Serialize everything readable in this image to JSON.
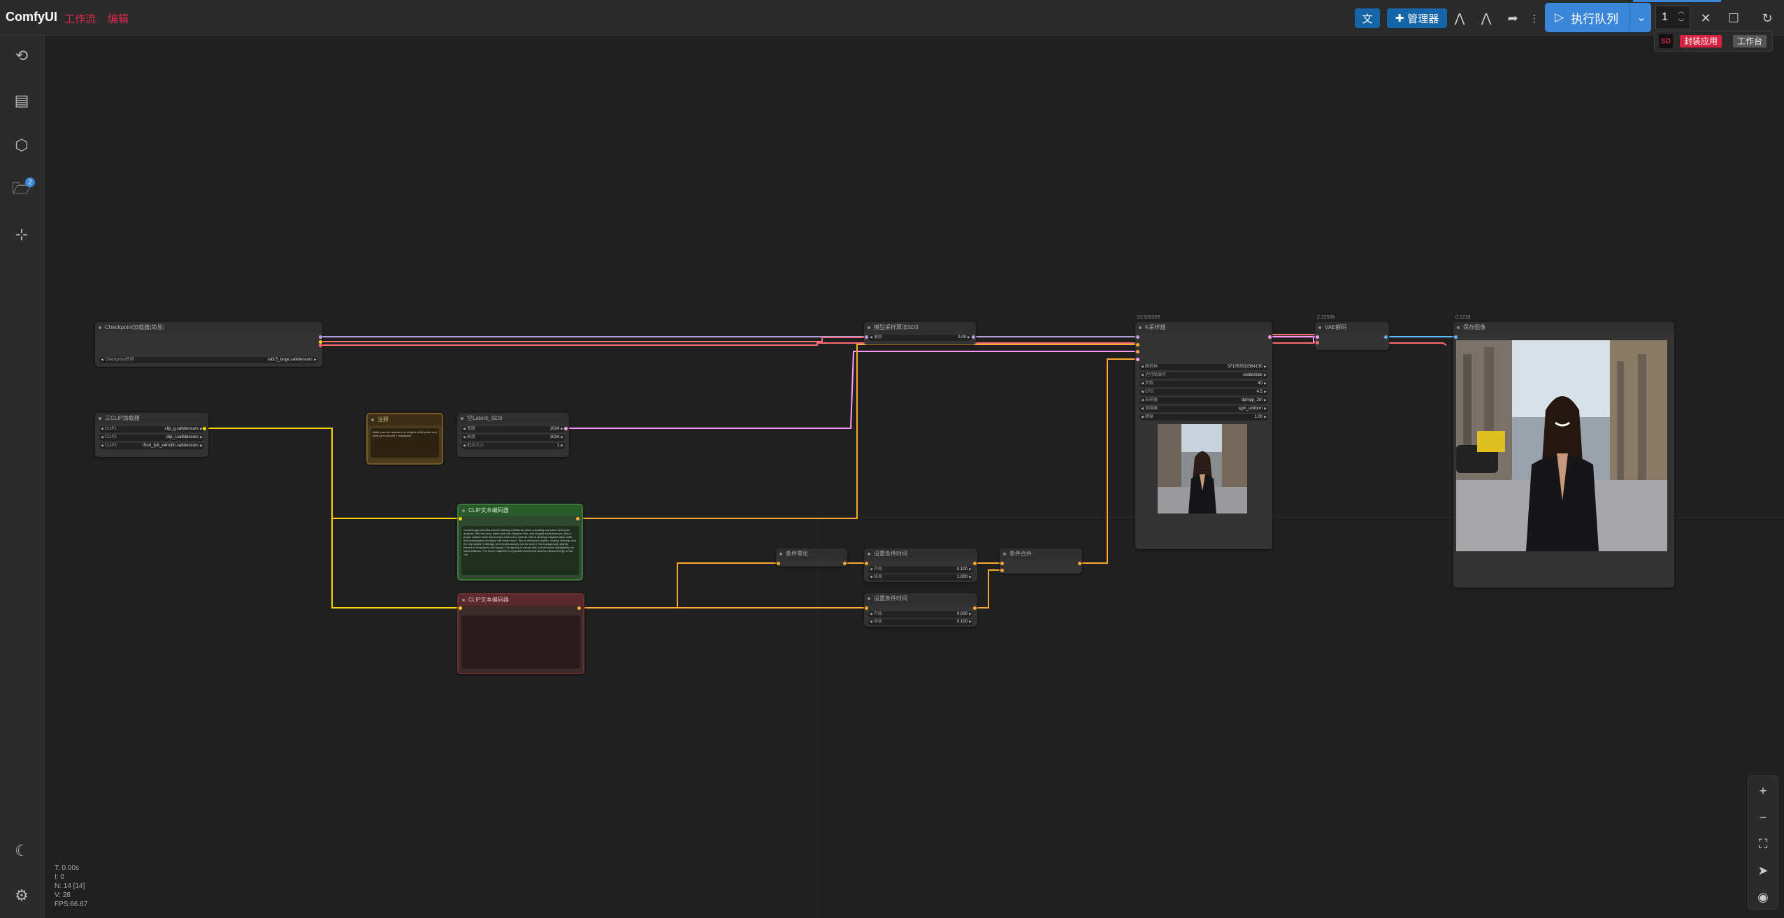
{
  "app": {
    "title": "ComfyUI",
    "menu": [
      "工作流",
      "编辑"
    ]
  },
  "toolbar": {
    "translate_label": "文",
    "manager_label": "管理器",
    "run_label": "执行队列",
    "batch_count": "1",
    "ext_logo": "SD",
    "ext_publish": "封装应用",
    "ext_workbench": "工作台"
  },
  "sidebar": {
    "queue_badge": "2"
  },
  "nodes": {
    "checkpoint": {
      "title": "Checkpoint加载器(简易)",
      "widget_label": "Checkpoint名称",
      "widget_value": "sd3.5_large.safetensors"
    },
    "clip_loader": {
      "title": "三CLIP加载器",
      "w1_label": "CLIP1",
      "w1_value": "clip_g.safetensors",
      "w2_label": "CLIP2",
      "w2_value": "clip_l.safetensors",
      "w3_label": "CLIP3",
      "w3_value": "t5xxl_fp8_e4m3fn.safetensors"
    },
    "note": {
      "title": "注释",
      "text": "Make sure the resolution is multiple of 64 pixels and adds up to around 1 megapixel."
    },
    "latent": {
      "title": "空Latent_SD3",
      "w1_label": "宽度",
      "w1_value": "1024",
      "w2_label": "高度",
      "w2_value": "1024",
      "w3_label": "批次大小",
      "w3_value": "1"
    },
    "pos_prompt": {
      "title": "CLIP文本编码器",
      "text": "A stunningly beautiful woman walking confidently down a bustling city street during the daytime. She has long, sleek dark hair, flawless skin, and elegant facial features, with a bright, radiant smile that exudes charm and warmth. She is wearing a stylish black outfit that accentuates her figure with bright eyes. She is dressed in stylish, modern clothing, and the city skyline, buildings, and streets activity can be seen in the background, slightly blurred to emphasize her beauty. The lighting is natural with soft shadows highlighting her facial features. The scene captures her graceful movement and the vibrant energy of the city."
    },
    "neg_prompt": {
      "title": "CLIP文本编码器",
      "text": ""
    },
    "sampling": {
      "title": "模型采样算法SD3",
      "w1_label": "偏移",
      "w1_value": "3.00"
    },
    "ksampler": {
      "title": "K采样器",
      "stat": "13.528289",
      "w1_label": "随机种",
      "w1_value": "371763532584130",
      "w2_label": "运行后操作",
      "w2_value": "randomize",
      "w3_label": "步数",
      "w3_value": "40",
      "w4_label": "CFG",
      "w4_value": "4.5",
      "w5_label": "采样器",
      "w5_value": "dpmpp_2m",
      "w6_label": "调度器",
      "w6_value": "sgm_uniform",
      "w7_label": "降噪",
      "w7_value": "1.00"
    },
    "vae_decode": {
      "title": "VAE解码",
      "stat": "2.22538"
    },
    "save_image": {
      "title": "保存图像",
      "stat": "0.1218"
    },
    "zero_out": {
      "title": "条件零化"
    },
    "timestep1": {
      "title": "设置条件时间",
      "w1_label": "开始",
      "w1_value": "0.100",
      "w2_label": "结束",
      "w2_value": "1.000"
    },
    "timestep2": {
      "title": "设置条件时间",
      "w1_label": "开始",
      "w1_value": "0.000",
      "w2_label": "结束",
      "w2_value": "0.100"
    },
    "combine": {
      "title": "条件合并"
    }
  },
  "status": {
    "t": "T: 0.00s",
    "i": "I: 0",
    "n": "N: 14 [14]",
    "v": "V: 28",
    "fps": "FPS:66.67"
  },
  "colors": {
    "model": "#b39ddb",
    "clip": "#ffd500",
    "vae": "#ff6e6e",
    "conditioning": "#ffa931",
    "latent": "#ff9cf9",
    "image": "#64b5f6"
  }
}
